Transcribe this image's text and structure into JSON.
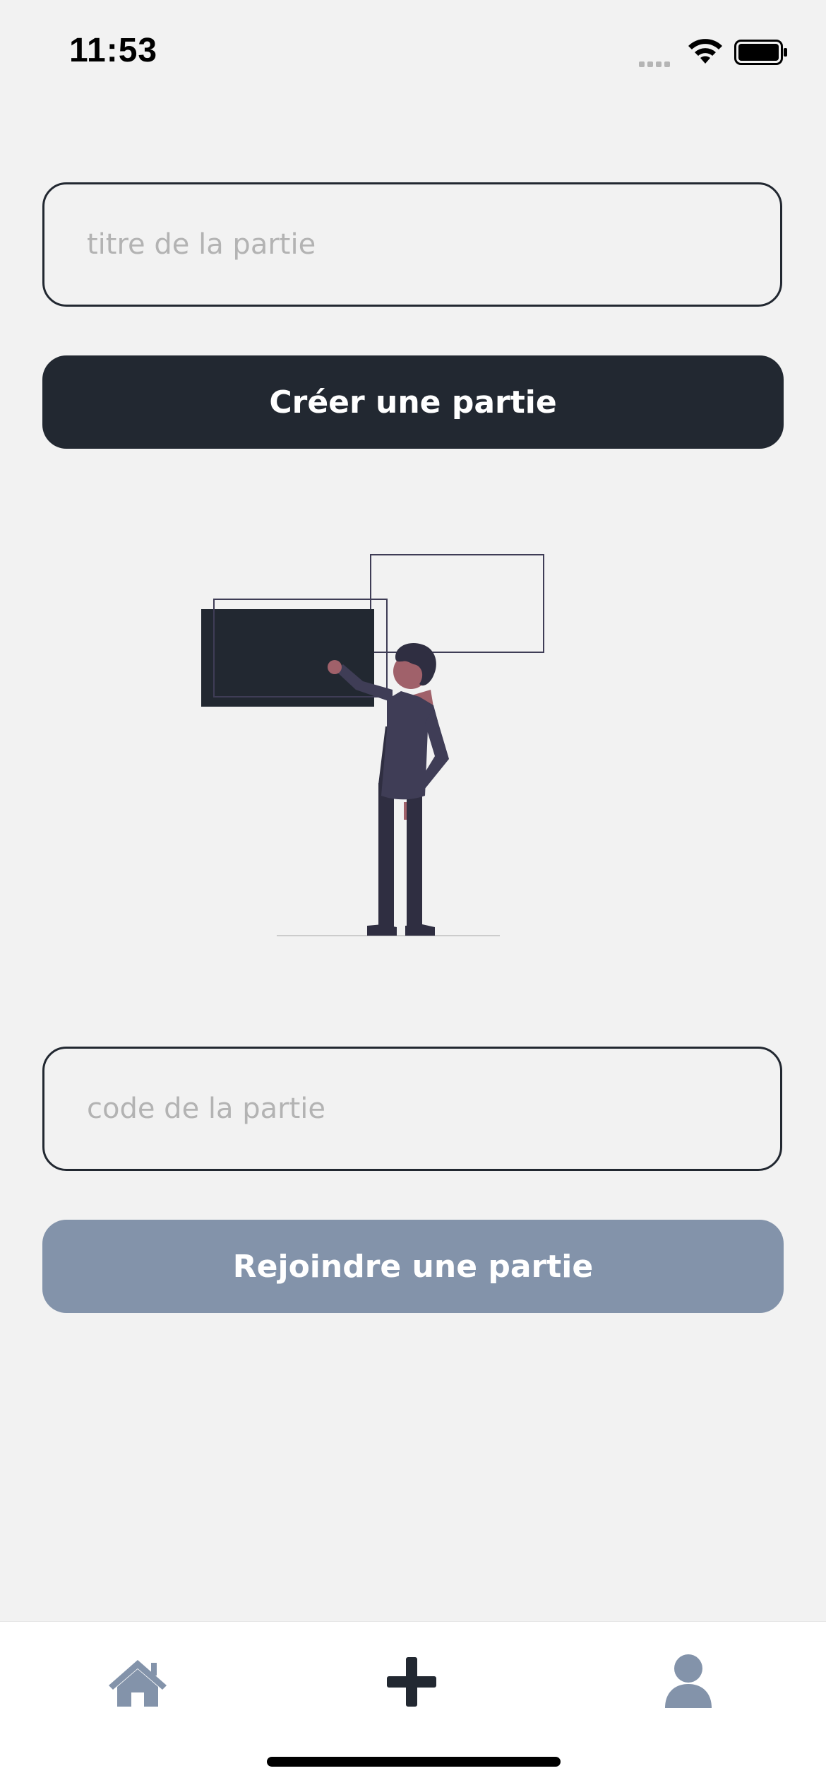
{
  "status_bar": {
    "time": "11:53"
  },
  "create": {
    "title_placeholder": "titre de la partie",
    "button_label": "Créer une partie"
  },
  "join": {
    "code_placeholder": "code de la partie",
    "button_label": "Rejoindre une partie"
  },
  "tab_bar": {
    "items": [
      {
        "icon": "home-icon"
      },
      {
        "icon": "plus-icon"
      },
      {
        "icon": "user-icon"
      }
    ]
  },
  "colors": {
    "background": "#f2f2f2",
    "primary": "#222831",
    "secondary_button": "#8393aa",
    "tab_inactive": "#8393aa",
    "placeholder": "#b3b3b3"
  }
}
